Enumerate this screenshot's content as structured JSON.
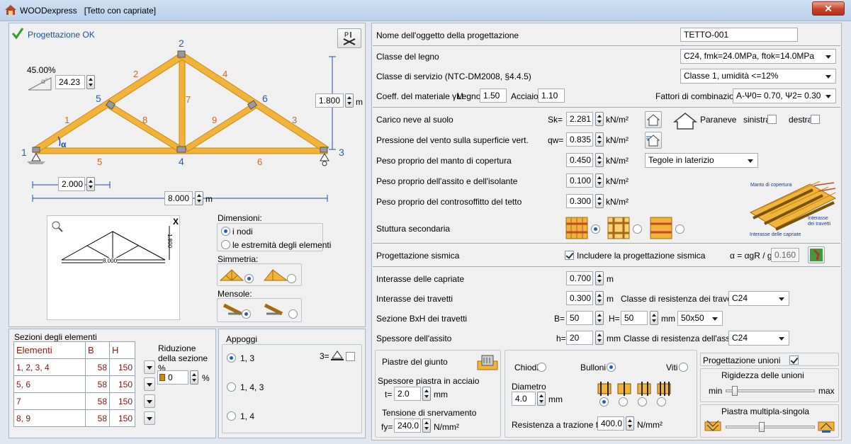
{
  "window": {
    "app": "WOODexpress",
    "doc": "[Tetto con capriate]",
    "close": "✕"
  },
  "status": {
    "text": "Progettazione OK"
  },
  "truss": {
    "nodes": [
      "1",
      "2",
      "3",
      "4",
      "5",
      "6"
    ],
    "elements": [
      "1",
      "2",
      "3",
      "4",
      "5",
      "6",
      "7",
      "8",
      "9"
    ],
    "slope_pct": "45.00%",
    "alpha_label": "α",
    "alpha_value": "24.23",
    "height_value": "1.800",
    "height_unit": "m",
    "offset_value": "2.000",
    "span_value": "8.000",
    "span_unit": "m",
    "preview_span": "8.000",
    "preview_height": "1.800",
    "preview_axis": "X"
  },
  "dimensions": {
    "label": "Dimensioni:",
    "opt1": "i nodi",
    "opt2": "le estremità degli elementi"
  },
  "symmetry": {
    "label": "Simmetria:"
  },
  "mensole": {
    "label": "Mensole:"
  },
  "sections": {
    "title": "Sezioni degli elementi",
    "headers": [
      "Elementi",
      "B",
      "H"
    ],
    "rows": [
      {
        "el": "1, 2, 3, 4",
        "b": "58",
        "h": "150"
      },
      {
        "el": "5, 6",
        "b": "58",
        "h": "150"
      },
      {
        "el": "7",
        "b": "58",
        "h": "150"
      },
      {
        "el": "8, 9",
        "b": "58",
        "h": "150"
      }
    ],
    "reduction_label": "Riduzione della sezione %",
    "reduction_value": "0",
    "reduction_unit": "%"
  },
  "appoggi": {
    "title": "Appoggi",
    "opt1": "1, 3",
    "opt2": "1, 4, 3",
    "opt3": "1, 4",
    "eq_label": "3="
  },
  "form": {
    "name_label": "Nome dell'oggetto della progettazione",
    "name_value": "TETTO-001",
    "wood_label": "Classe del legno",
    "wood_value": "C24, fmk=24.0MPa, ftok=14.0MPa",
    "service_label": "Classe di servizio (NTC-DM2008, §4.4.5)",
    "service_value": "Classe 1, umidità <=12%",
    "coeff_label": "Coeff. del materiale γM",
    "legno_label": "Legno",
    "legno_value": "1.50",
    "acciaio_label": "Acciaio",
    "acciaio_value": "1.10",
    "comb_label": "Fattori di combinazione",
    "comb_value": "A-Ψ0= 0.70, Ψ2= 0.30"
  },
  "loads": {
    "snow_label": "Carico neve al suolo",
    "snow_sym": "Sk=",
    "snow_value": "2.281",
    "unit": "kN/m²",
    "paraneve": "Paraneve",
    "sinistra": "sinistra",
    "destra": "destra",
    "wind_label": "Pressione del vento sulla superficie vert.",
    "wind_sym": "qw=",
    "wind_value": "0.835",
    "roof_label": "Peso proprio del manto di copertura",
    "roof_value": "0.450",
    "roof_type": "Tegole in laterizio",
    "deck_label": "Peso proprio dell'assito e dell'isolante",
    "deck_value": "0.100",
    "ceil_label": "Peso proprio del controsoffitto del tetto",
    "ceil_value": "0.300",
    "secondary_label": "Stuttura secondaria",
    "img_manto": "Manto di copertura",
    "img_travetti": "Interasse dei travetti",
    "img_capriate": "Interasse delle capriate"
  },
  "seismic": {
    "label": "Progettazione sismica",
    "include_label": "Includere la progettazione sismica",
    "alpha_label": "α = αgR / g",
    "alpha_value": "0.160"
  },
  "spacing": {
    "capriate_label": "Interasse delle capriate",
    "capriate_value": "0.700",
    "travetti_label": "Interasse dei travetti",
    "travetti_value": "0.300",
    "m": "m",
    "travetti_class_label": "Classe di resistenza dei travetti",
    "travetti_class": "C24",
    "sezione_label": "Sezione BxH dei travetti",
    "b_sym": "B=",
    "b_value": "50",
    "h_sym": "H=",
    "h_value": "50",
    "mm": "mm",
    "sez_value": "50x50",
    "assito_label": "Spessore dell'assito",
    "assito_sym": "h=",
    "assito_value": "20",
    "assito_class_label": "Classe di resistenza dell'assito",
    "assito_class": "C24"
  },
  "plates": {
    "title": "Piastre del giunto",
    "thick_label": "Spessore piastra in acciaio",
    "thick_sym": "t=",
    "thick_value": "2.0",
    "mm": "mm",
    "yield_label": "Tensione di snervamento",
    "yield_sym": "fy=",
    "yield_value": "240.0",
    "stress_unit": "N/mm²"
  },
  "fasteners": {
    "chiodi": "Chiodi",
    "bulloni": "Bulloni",
    "viti": "Viti",
    "diam_label": "Diametro",
    "diam_value": "4.0",
    "mm": "mm",
    "tensile_label": "Resistenza a trazione fu=",
    "tensile_value": "400.0",
    "stress_unit": "N/mm²"
  },
  "unions": {
    "title": "Progettazione unioni",
    "rigidity_label": "Rigidezza delle unioni",
    "rigidity_level": 0.08,
    "min": "min",
    "max": "max",
    "plate_label": "Piastra multipla-singola",
    "plate_level": 0.4
  },
  "colors": {
    "timber": "#f2b33a",
    "timber_edge": "#c98a10",
    "node_blue": "#2a5db0",
    "elem_orange": "#c76a2a"
  }
}
